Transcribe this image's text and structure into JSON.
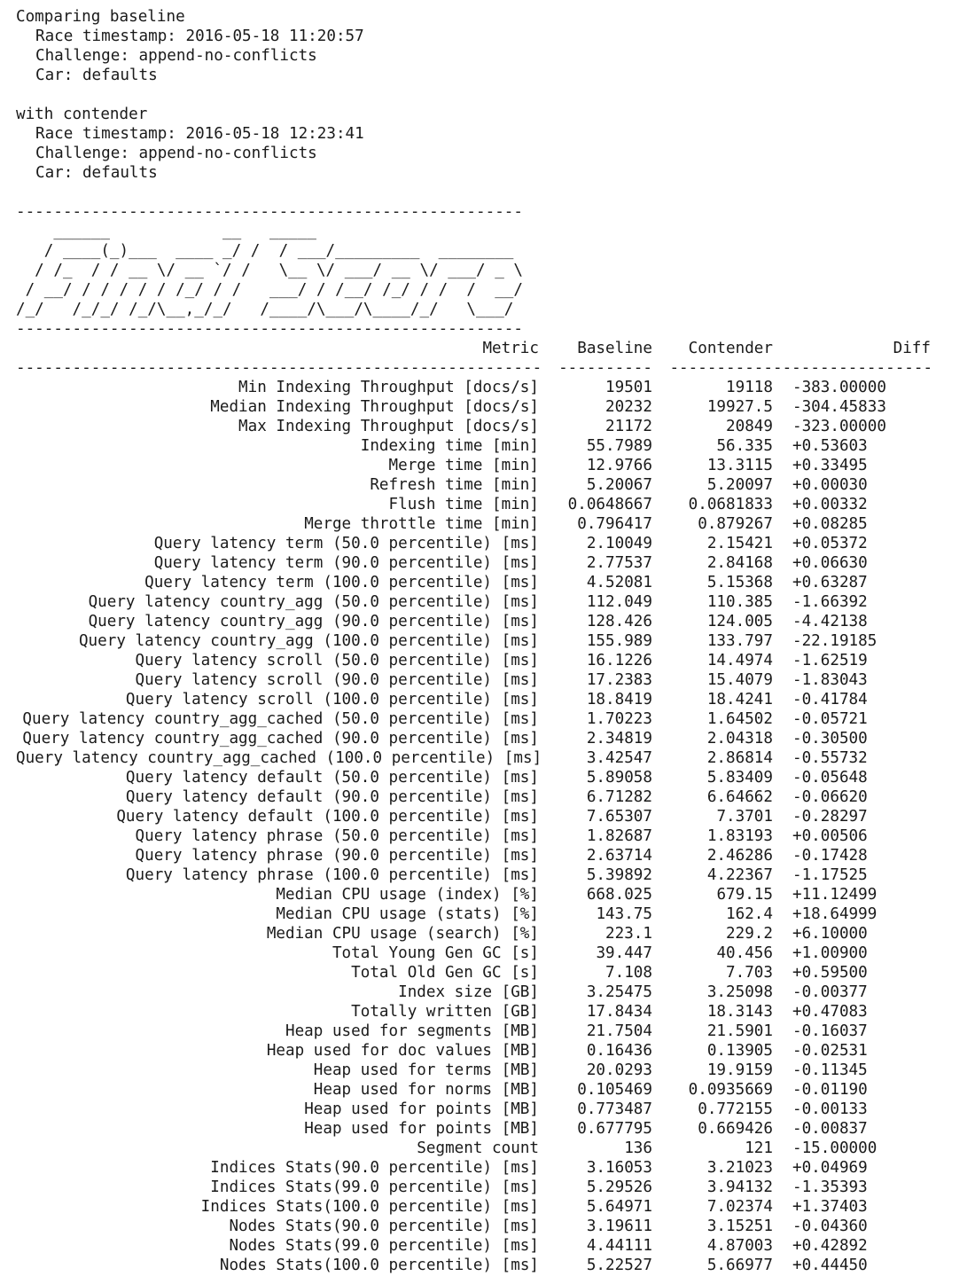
{
  "header": {
    "baseline_intro": "Comparing baseline",
    "baseline": {
      "race_timestamp": "Race timestamp: 2016-05-18 11:20:57",
      "challenge": "Challenge: append-no-conflicts",
      "car": "Car: defaults"
    },
    "contender_intro": "with contender",
    "contender": {
      "race_timestamp": "Race timestamp: 2016-05-18 12:23:41",
      "challenge": "Challenge: append-no-conflicts",
      "car": "Car: defaults"
    }
  },
  "separator_short": "------------------------------------------------------",
  "banner_art": "    ______            __   _____\n   / ____(_)___  ____ _/ /  / ___/_________  ________\n  / /_  / / __ \\/ __ `/ /   \\__ \\/ ___/ __ \\/ ___/ _ \\\n / __/ / / / / / /_/ / /   ___/ / /__/ /_/ / /  /  __/\n/_/   /_/_/ /_/\\__,_/_/   /____/\\___/\\____/_/   \\___/",
  "table": {
    "headers": {
      "metric": "Metric",
      "baseline": "Baseline",
      "contender": "Contender",
      "diff": "Diff"
    },
    "header_rules": {
      "metric": "--------------------------------------------------------",
      "baseline": "----------",
      "contender": "-----------",
      "diff": "-----------------"
    },
    "rows": [
      {
        "metric": "Min Indexing Throughput [docs/s]",
        "baseline": "19501",
        "contender": "19118",
        "diff": "-383.00000"
      },
      {
        "metric": "Median Indexing Throughput [docs/s]",
        "baseline": "20232",
        "contender": "19927.5",
        "diff": "-304.45833"
      },
      {
        "metric": "Max Indexing Throughput [docs/s]",
        "baseline": "21172",
        "contender": "20849",
        "diff": "-323.00000"
      },
      {
        "metric": "Indexing time [min]",
        "baseline": "55.7989",
        "contender": "56.335",
        "diff": "+0.53603"
      },
      {
        "metric": "Merge time [min]",
        "baseline": "12.9766",
        "contender": "13.3115",
        "diff": "+0.33495"
      },
      {
        "metric": "Refresh time [min]",
        "baseline": "5.20067",
        "contender": "5.20097",
        "diff": "+0.00030"
      },
      {
        "metric": "Flush time [min]",
        "baseline": "0.0648667",
        "contender": "0.0681833",
        "diff": "+0.00332"
      },
      {
        "metric": "Merge throttle time [min]",
        "baseline": "0.796417",
        "contender": "0.879267",
        "diff": "+0.08285"
      },
      {
        "metric": "Query latency term (50.0 percentile) [ms]",
        "baseline": "2.10049",
        "contender": "2.15421",
        "diff": "+0.05372"
      },
      {
        "metric": "Query latency term (90.0 percentile) [ms]",
        "baseline": "2.77537",
        "contender": "2.84168",
        "diff": "+0.06630"
      },
      {
        "metric": "Query latency term (100.0 percentile) [ms]",
        "baseline": "4.52081",
        "contender": "5.15368",
        "diff": "+0.63287"
      },
      {
        "metric": "Query latency country_agg (50.0 percentile) [ms]",
        "baseline": "112.049",
        "contender": "110.385",
        "diff": "-1.66392"
      },
      {
        "metric": "Query latency country_agg (90.0 percentile) [ms]",
        "baseline": "128.426",
        "contender": "124.005",
        "diff": "-4.42138"
      },
      {
        "metric": "Query latency country_agg (100.0 percentile) [ms]",
        "baseline": "155.989",
        "contender": "133.797",
        "diff": "-22.19185"
      },
      {
        "metric": "Query latency scroll (50.0 percentile) [ms]",
        "baseline": "16.1226",
        "contender": "14.4974",
        "diff": "-1.62519"
      },
      {
        "metric": "Query latency scroll (90.0 percentile) [ms]",
        "baseline": "17.2383",
        "contender": "15.4079",
        "diff": "-1.83043"
      },
      {
        "metric": "Query latency scroll (100.0 percentile) [ms]",
        "baseline": "18.8419",
        "contender": "18.4241",
        "diff": "-0.41784"
      },
      {
        "metric": "Query latency country_agg_cached (50.0 percentile) [ms]",
        "baseline": "1.70223",
        "contender": "1.64502",
        "diff": "-0.05721"
      },
      {
        "metric": "Query latency country_agg_cached (90.0 percentile) [ms]",
        "baseline": "2.34819",
        "contender": "2.04318",
        "diff": "-0.30500"
      },
      {
        "metric": "Query latency country_agg_cached (100.0 percentile) [ms]",
        "baseline": "3.42547",
        "contender": "2.86814",
        "diff": "-0.55732"
      },
      {
        "metric": "Query latency default (50.0 percentile) [ms]",
        "baseline": "5.89058",
        "contender": "5.83409",
        "diff": "-0.05648"
      },
      {
        "metric": "Query latency default (90.0 percentile) [ms]",
        "baseline": "6.71282",
        "contender": "6.64662",
        "diff": "-0.06620"
      },
      {
        "metric": "Query latency default (100.0 percentile) [ms]",
        "baseline": "7.65307",
        "contender": "7.3701",
        "diff": "-0.28297"
      },
      {
        "metric": "Query latency phrase (50.0 percentile) [ms]",
        "baseline": "1.82687",
        "contender": "1.83193",
        "diff": "+0.00506"
      },
      {
        "metric": "Query latency phrase (90.0 percentile) [ms]",
        "baseline": "2.63714",
        "contender": "2.46286",
        "diff": "-0.17428"
      },
      {
        "metric": "Query latency phrase (100.0 percentile) [ms]",
        "baseline": "5.39892",
        "contender": "4.22367",
        "diff": "-1.17525"
      },
      {
        "metric": "Median CPU usage (index) [%]",
        "baseline": "668.025",
        "contender": "679.15",
        "diff": "+11.12499"
      },
      {
        "metric": "Median CPU usage (stats) [%]",
        "baseline": "143.75",
        "contender": "162.4",
        "diff": "+18.64999"
      },
      {
        "metric": "Median CPU usage (search) [%]",
        "baseline": "223.1",
        "contender": "229.2",
        "diff": "+6.10000"
      },
      {
        "metric": "Total Young Gen GC [s]",
        "baseline": "39.447",
        "contender": "40.456",
        "diff": "+1.00900"
      },
      {
        "metric": "Total Old Gen GC [s]",
        "baseline": "7.108",
        "contender": "7.703",
        "diff": "+0.59500"
      },
      {
        "metric": "Index size [GB]",
        "baseline": "3.25475",
        "contender": "3.25098",
        "diff": "-0.00377"
      },
      {
        "metric": "Totally written [GB]",
        "baseline": "17.8434",
        "contender": "18.3143",
        "diff": "+0.47083"
      },
      {
        "metric": "Heap used for segments [MB]",
        "baseline": "21.7504",
        "contender": "21.5901",
        "diff": "-0.16037"
      },
      {
        "metric": "Heap used for doc values [MB]",
        "baseline": "0.16436",
        "contender": "0.13905",
        "diff": "-0.02531"
      },
      {
        "metric": "Heap used for terms [MB]",
        "baseline": "20.0293",
        "contender": "19.9159",
        "diff": "-0.11345"
      },
      {
        "metric": "Heap used for norms [MB]",
        "baseline": "0.105469",
        "contender": "0.0935669",
        "diff": "-0.01190"
      },
      {
        "metric": "Heap used for points [MB]",
        "baseline": "0.773487",
        "contender": "0.772155",
        "diff": "-0.00133"
      },
      {
        "metric": "Heap used for points [MB]",
        "baseline": "0.677795",
        "contender": "0.669426",
        "diff": "-0.00837"
      },
      {
        "metric": "Segment count",
        "baseline": "136",
        "contender": "121",
        "diff": "-15.00000"
      },
      {
        "metric": "Indices Stats(90.0 percentile) [ms]",
        "baseline": "3.16053",
        "contender": "3.21023",
        "diff": "+0.04969"
      },
      {
        "metric": "Indices Stats(99.0 percentile) [ms]",
        "baseline": "5.29526",
        "contender": "3.94132",
        "diff": "-1.35393"
      },
      {
        "metric": "Indices Stats(100.0 percentile) [ms]",
        "baseline": "5.64971",
        "contender": "7.02374",
        "diff": "+1.37403"
      },
      {
        "metric": "Nodes Stats(90.0 percentile) [ms]",
        "baseline": "3.19611",
        "contender": "3.15251",
        "diff": "-0.04360"
      },
      {
        "metric": "Nodes Stats(99.0 percentile) [ms]",
        "baseline": "4.44111",
        "contender": "4.87003",
        "diff": "+0.42892"
      },
      {
        "metric": "Nodes Stats(100.0 percentile) [ms]",
        "baseline": "5.22527",
        "contender": "5.66977",
        "diff": "+0.44450"
      }
    ]
  }
}
